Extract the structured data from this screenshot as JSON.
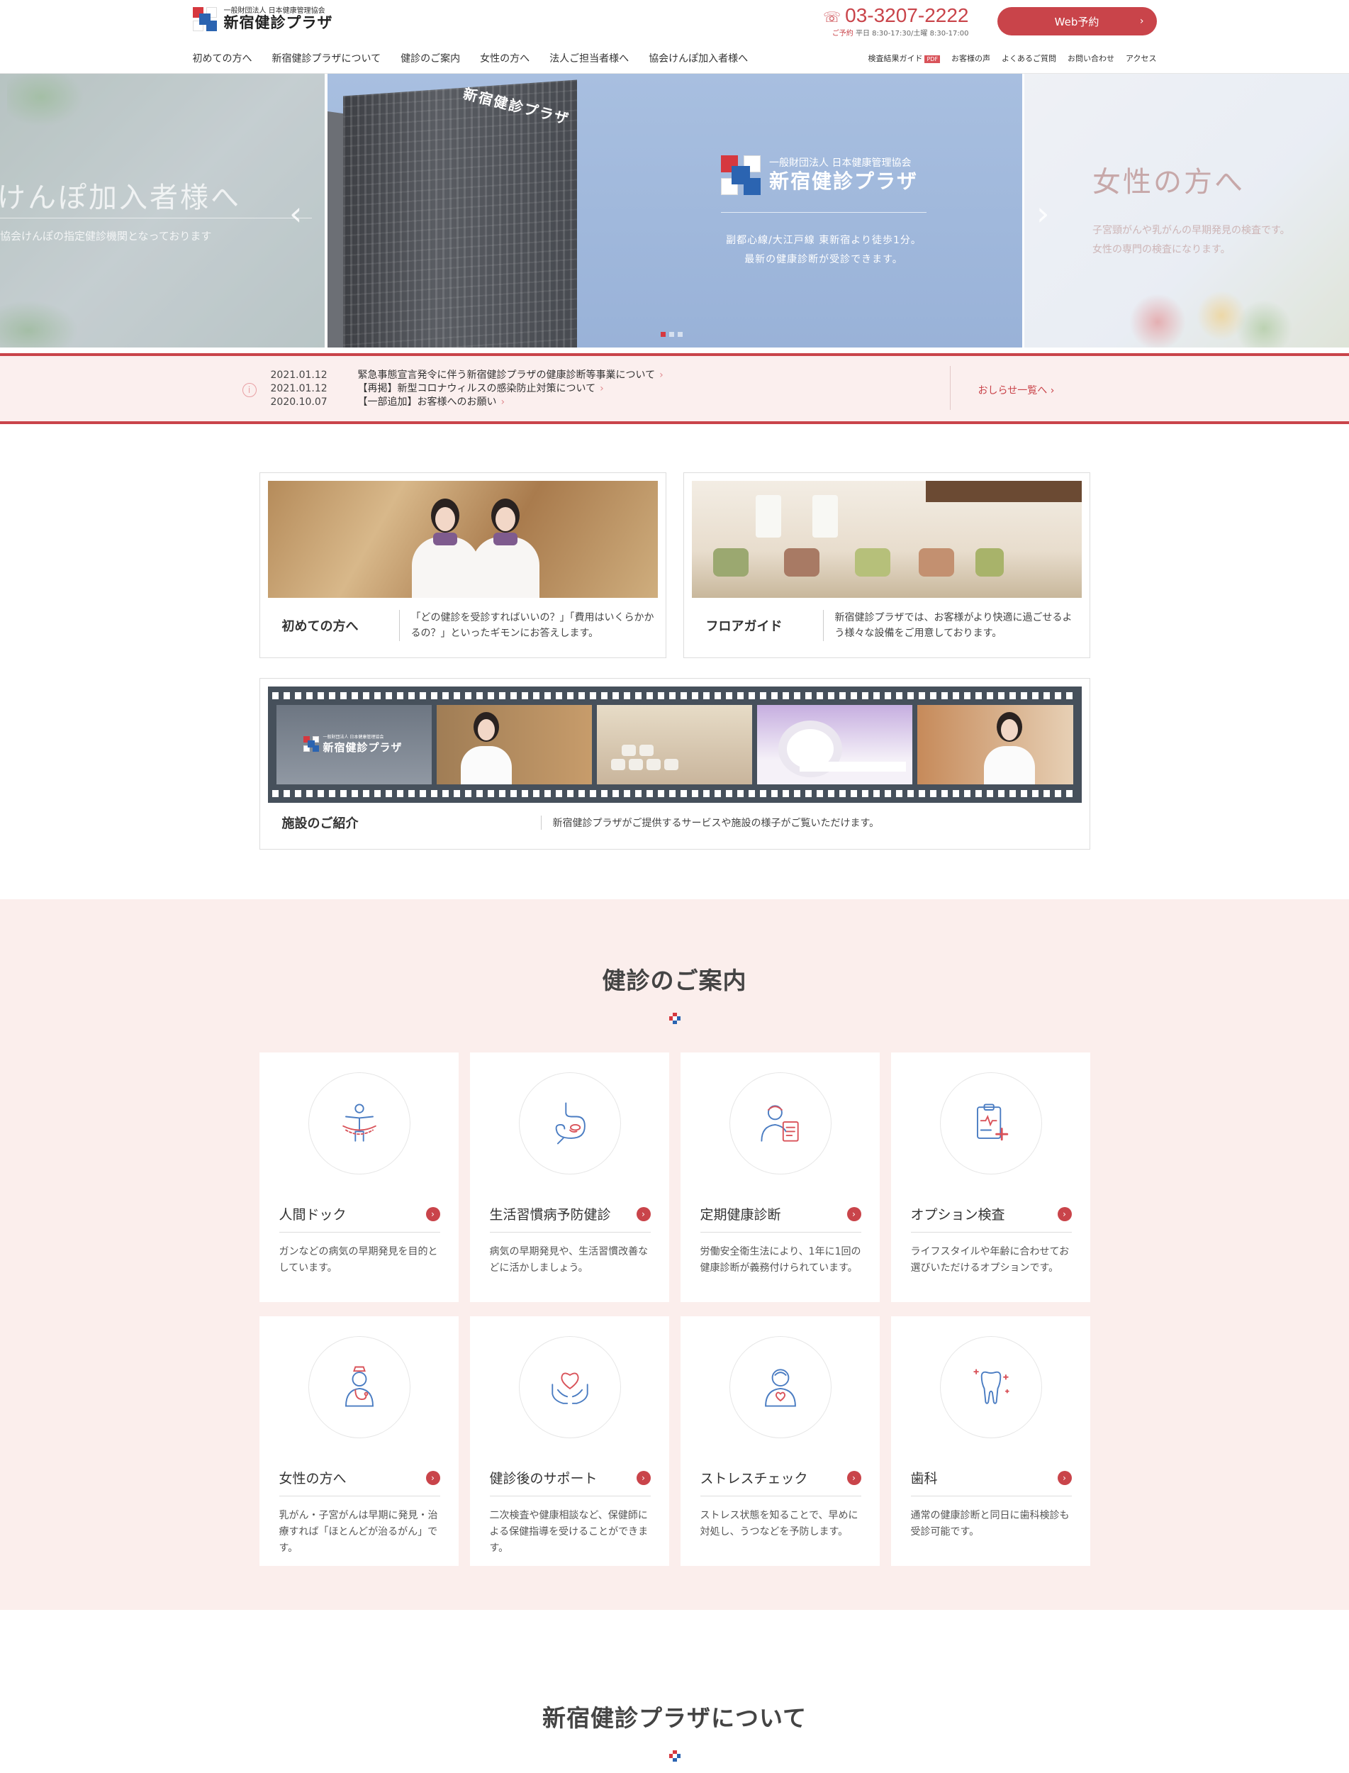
{
  "header": {
    "logo_sub": "一般財団法人 日本健康管理協会",
    "logo_main": "新宿健診プラザ",
    "tel_number": "03-3207-2222",
    "tel_label": "ご予約",
    "tel_hours": "平日 8:30-17:30/土曜 8:30-17:00",
    "web_button": "Web予約",
    "main_nav": [
      "初めての方へ",
      "新宿健診プラザについて",
      "健診のご案内",
      "女性の方へ",
      "法人ご担当者様へ",
      "協会けんぽ加入者様へ"
    ],
    "sub_nav": [
      "検査結果ガイド",
      "お客様の声",
      "よくあるご質問",
      "お問い合わせ",
      "アクセス"
    ],
    "pdf_badge": "PDF"
  },
  "hero": {
    "left_title": "けんぽ加入者様へ",
    "left_desc": "協会けんぽの指定健診機関となっております",
    "main_logo_sub": "一般財団法人 日本健康管理協会",
    "main_logo_main": "新宿健診プラザ",
    "main_copy_1": "副都心線/大江戸線 東新宿より徒歩1分。",
    "main_copy_2": "最新の健康診断が受診できます。",
    "building_sign": "新宿健診プラザ",
    "right_title": "女性の方へ",
    "right_desc_1": "子宮頸がんや乳がんの早期発見の検査です。",
    "right_desc_2": "女性の専門の検査になります。",
    "current_slide": 1,
    "slide_count": 3
  },
  "news": {
    "items": [
      {
        "date": "2021.01.12",
        "title": "緊急事態宣言発令に伴う新宿健診プラザの健康診断等事業について"
      },
      {
        "date": "2021.01.12",
        "title": "【再掲】新型コロナウィルスの感染防止対策について"
      },
      {
        "date": "2020.10.07",
        "title": "【一部追加】お客様へのお願い"
      }
    ],
    "more": "おしらせ一覧へ"
  },
  "info_cards": {
    "first": {
      "title": "初めての方へ",
      "desc": "「どの健診を受診すればいいの？」「費用はいくらかかるの？」といったギモンにお答えします。"
    },
    "floor": {
      "title": "フロアガイド",
      "desc": "新宿健診プラザでは、お客様がより快適に過ごせるよう様々な設備をご用意しております。"
    },
    "facility": {
      "title": "施設のご紹介",
      "desc": "新宿健診プラザがご提供するサービスや施設の様子がご覧いただけます。",
      "film_logo_sub": "一般財団法人 日本健康管理協会",
      "film_logo_main": "新宿健診プラザ"
    }
  },
  "checkup": {
    "title": "健診のご案内",
    "items": [
      {
        "title": "人間ドック",
        "desc": "ガンなどの病気の早期発見を目的としています。",
        "icon": "body-icon"
      },
      {
        "title": "生活習慣病予防健診",
        "desc": "病気の早期発見や、生活習慣改善などに活かしましょう。",
        "icon": "stomach-icon"
      },
      {
        "title": "定期健康診断",
        "desc": "労働安全衛生法により、1年に1回の健康診断が義務付けられています。",
        "icon": "doctor-clipboard-icon"
      },
      {
        "title": "オプション検査",
        "desc": "ライフスタイルや年齢に合わせてお選びいただけるオプションです。",
        "icon": "medical-chart-icon"
      },
      {
        "title": "女性の方へ",
        "desc": "乳がん・子宮がんは早期に発見・治療すれば「ほとんどが治るがん」です。",
        "icon": "nurse-icon"
      },
      {
        "title": "健診後のサポート",
        "desc": "二次検査や健康相談など、保健師による保健指導を受けることができます。",
        "icon": "heart-hands-icon"
      },
      {
        "title": "ストレスチェック",
        "desc": "ストレス状態を知ることで、早めに対処し、うつなどを予防します。",
        "icon": "person-heart-icon"
      },
      {
        "title": "歯科",
        "desc": "通常の健康診断と同日に歯科検診も受診可能です。",
        "icon": "tooth-icon"
      }
    ]
  },
  "about": {
    "title": "新宿健診プラザについて"
  },
  "colors": {
    "accent_red": "#c9444a",
    "brand_blue": "#2b64b1",
    "section_bg": "#fbeeec"
  }
}
